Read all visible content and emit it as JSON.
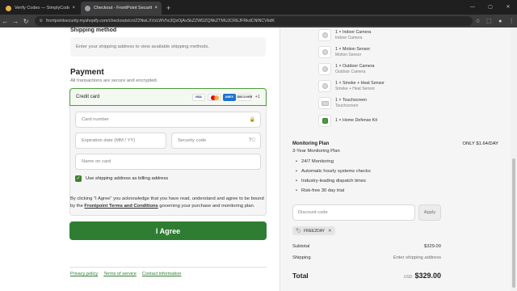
{
  "browser": {
    "tabs": [
      {
        "title": "Verify Codes — SimplyCodes",
        "close": "×"
      },
      {
        "title": "Checkout - FrontPoint Security",
        "close": "×"
      }
    ],
    "new_tab": "+",
    "url": "frontpointsecurity.myshopify.com/checkouts/cn/Z2NwLXVzLWVhc3QxOjAxSkZZWDZQNkZTMUJCREJFRkdCNlNCVkdK",
    "window_controls": {
      "minimize": "—",
      "maximize": "▢",
      "close": "✕"
    },
    "nav": {
      "back": "←",
      "forward": "→",
      "reload": "↻"
    }
  },
  "shipping": {
    "heading": "Shipping method",
    "placeholder": "Enter your shipping address to view available shipping methods."
  },
  "payment": {
    "heading": "Payment",
    "subtitle": "All transactions are secure and encrypted.",
    "method_label": "Credit card",
    "card_brands": [
      "VISA",
      "MC",
      "AMEX",
      "DISCOVER"
    ],
    "more_cards": "+1",
    "fields": {
      "card_number": "Card number",
      "expiration": "Expiration date (MM / YY)",
      "security_code": "Security code",
      "name_on_card": "Name on card"
    },
    "billing_checkbox": "Use shipping address as billing address",
    "billing_checked": true
  },
  "consent": {
    "text_before": "By clicking \"I Agree\" you acknowledge that you have read, understand and agree to be bound by the ",
    "link": "Frontpoint Terms and Conditions",
    "text_after": " governing your purchase and monitoring plan."
  },
  "agree_button": "I Agree",
  "footer_links": [
    "Privacy policy",
    "Terms of service",
    "Contact information"
  ],
  "order": {
    "items": [
      {
        "name": "1 × Indoor Camera",
        "sub": "Indoor Camera"
      },
      {
        "name": "1 × Motion Sensor",
        "sub": "Motion Sensor"
      },
      {
        "name": "1 × Outdoor Camera",
        "sub": "Outdoor Camera"
      },
      {
        "name": "1 × Smoke + Heat Sensor",
        "sub": "Smoke + Heat Sensor"
      },
      {
        "name": "1 × Touchscreen",
        "sub": "Touchscreen"
      },
      {
        "name": "1 × Home Defense Kit",
        "sub": ""
      }
    ],
    "plan": {
      "title": "Monitoring Plan",
      "price": "ONLY $1.64/DAY",
      "subtitle": "3-Year Monitoring Plan",
      "features": [
        "24/7 Monitoring",
        "Automatic hourly systems checks",
        "Industry-leading dispatch times",
        "Risk-free 30 day trial"
      ]
    },
    "discount_placeholder": "Discount code",
    "apply_label": "Apply",
    "applied_code": "FREE2DAY",
    "subtotal_label": "Subtotal",
    "subtotal_value": "$329.00",
    "shipping_label": "Shipping",
    "shipping_value": "Enter shipping address",
    "total_label": "Total",
    "currency": "USD",
    "total_value": "$329.00"
  },
  "colors": {
    "accent": "#2f7d32",
    "chrome_dark": "#1f1f1f"
  }
}
